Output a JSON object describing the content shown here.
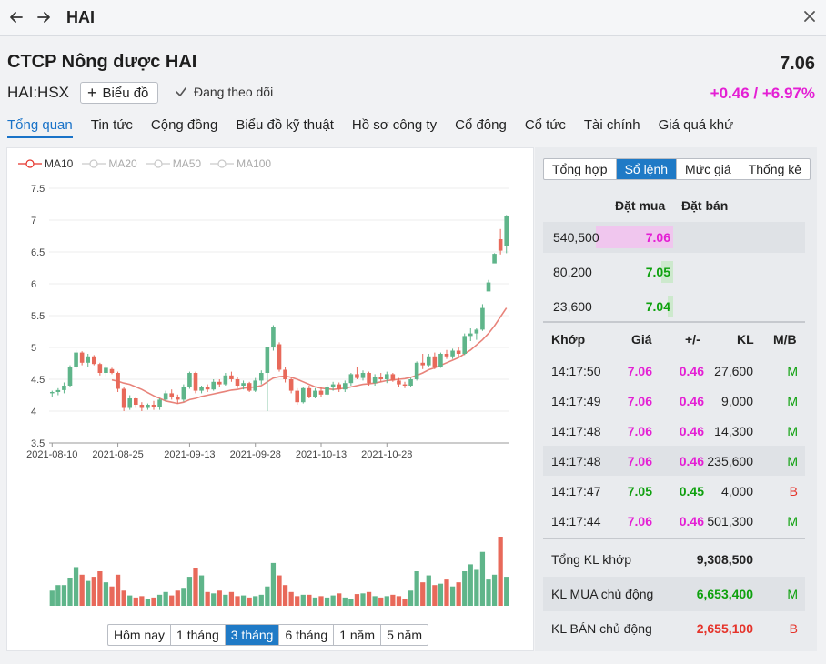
{
  "window": {
    "title": "HAI"
  },
  "header": {
    "company": "CTCP Nông dược HAI",
    "ticker": "HAI:HSX",
    "chart_button": "Biểu đồ",
    "follow_label": "Đang theo dõi",
    "price": "7.06",
    "change": "+0.46 / +6.97%",
    "change_color": "#e41fd4"
  },
  "tabs": [
    "Tổng quan",
    "Tin tức",
    "Cộng đồng",
    "Biểu đồ kỹ thuật",
    "Hồ sơ công ty",
    "Cổ đông",
    "Cổ tức",
    "Tài chính",
    "Giá quá khứ"
  ],
  "legend": [
    "MA10",
    "MA20",
    "MA50",
    "MA100"
  ],
  "range_buttons": [
    "Hôm nay",
    "1 tháng",
    "3 tháng",
    "6 tháng",
    "1 năm",
    "5 năm"
  ],
  "right_tabs": [
    "Tổng hợp",
    "Sổ lệnh",
    "Mức giá",
    "Thống kê"
  ],
  "order_book": {
    "head_buy": "Đặt mua",
    "head_sell": "Đặt bán",
    "rows": [
      {
        "volume": "540,500",
        "price": "7.06",
        "color": "#e41fd4",
        "bar_fraction": 1.0,
        "bar_color": "#f0c6ee"
      },
      {
        "volume": "80,200",
        "price": "7.05",
        "color": "#0ea10e",
        "bar_fraction": 0.15,
        "bar_color": "#cde9cd"
      },
      {
        "volume": "23,600",
        "price": "7.04",
        "color": "#0ea10e",
        "bar_fraction": 0.05,
        "bar_color": "#cde9cd"
      }
    ]
  },
  "trades": {
    "headers": {
      "time": "Khớp",
      "price": "Giá",
      "change": "+/-",
      "volume": "KL",
      "side": "M/B"
    },
    "rows": [
      {
        "time": "14:17:50",
        "price": "7.06",
        "change": "0.46",
        "volume": "27,600",
        "side": "M",
        "price_color": "pink",
        "side_color": "green"
      },
      {
        "time": "14:17:49",
        "price": "7.06",
        "change": "0.46",
        "volume": "9,000",
        "side": "M",
        "price_color": "pink",
        "side_color": "green"
      },
      {
        "time": "14:17:48",
        "price": "7.06",
        "change": "0.46",
        "volume": "14,300",
        "side": "M",
        "price_color": "pink",
        "side_color": "green"
      },
      {
        "time": "14:17:48",
        "price": "7.06",
        "change": "0.46",
        "volume": "235,600",
        "side": "M",
        "price_color": "pink",
        "side_color": "green"
      },
      {
        "time": "14:17:47",
        "price": "7.05",
        "change": "0.45",
        "volume": "4,000",
        "side": "B",
        "price_color": "green",
        "side_color": "red"
      },
      {
        "time": "14:17:44",
        "price": "7.06",
        "change": "0.46",
        "volume": "501,300",
        "side": "M",
        "price_color": "pink",
        "side_color": "green"
      }
    ]
  },
  "summary": [
    {
      "label": "Tổng KL khớp",
      "value": "9,308,500",
      "side": "",
      "color": "#222222"
    },
    {
      "label": "KL MUA chủ động",
      "value": "6,653,400",
      "side": "M",
      "color": "#0ea10e"
    },
    {
      "label": "KL BÁN chủ động",
      "value": "2,655,100",
      "side": "B",
      "color": "#e5332a"
    }
  ],
  "chart_data": {
    "type": "candlestick",
    "y_ticks": [
      "7.5",
      "7",
      "6.5",
      "6",
      "5.5",
      "5",
      "4.5",
      "4",
      "3.5"
    ],
    "ylim": [
      3.5,
      7.5
    ],
    "x_ticks": [
      "2021-08-10",
      "2021-08-25",
      "2021-09-13",
      "2021-09-28",
      "2021-10-13",
      "2021-10-28"
    ],
    "up_color": "#5fb58a",
    "down_color": "#e8695a",
    "ma_color": "#e8837a",
    "candles": [
      [
        4.28,
        4.32,
        4.22,
        4.3
      ],
      [
        4.3,
        4.36,
        4.25,
        4.33
      ],
      [
        4.33,
        4.45,
        4.28,
        4.4
      ],
      [
        4.4,
        4.72,
        4.38,
        4.7
      ],
      [
        4.7,
        4.96,
        4.66,
        4.92
      ],
      [
        4.92,
        4.94,
        4.72,
        4.76
      ],
      [
        4.76,
        4.9,
        4.7,
        4.86
      ],
      [
        4.86,
        4.88,
        4.72,
        4.74
      ],
      [
        4.74,
        4.76,
        4.56,
        4.6
      ],
      [
        4.6,
        4.72,
        4.55,
        4.68
      ],
      [
        4.66,
        4.68,
        4.58,
        4.6
      ],
      [
        4.6,
        4.62,
        4.3,
        4.35
      ],
      [
        4.35,
        4.38,
        4.0,
        4.05
      ],
      [
        4.05,
        4.25,
        4.02,
        4.2
      ],
      [
        4.2,
        4.22,
        4.05,
        4.1
      ],
      [
        4.1,
        4.14,
        4.0,
        4.05
      ],
      [
        4.05,
        4.12,
        4.02,
        4.1
      ],
      [
        4.1,
        4.16,
        4.02,
        4.06
      ],
      [
        4.06,
        4.2,
        4.02,
        4.18
      ],
      [
        4.18,
        4.32,
        4.15,
        4.28
      ],
      [
        4.28,
        4.34,
        4.18,
        4.22
      ],
      [
        4.22,
        4.26,
        4.12,
        4.18
      ],
      [
        4.18,
        4.42,
        4.15,
        4.38
      ],
      [
        4.38,
        4.62,
        4.35,
        4.6
      ],
      [
        4.6,
        4.62,
        4.28,
        4.32
      ],
      [
        4.32,
        4.4,
        4.28,
        4.38
      ],
      [
        4.38,
        4.42,
        4.3,
        4.34
      ],
      [
        4.34,
        4.5,
        4.32,
        4.46
      ],
      [
        4.46,
        4.5,
        4.38,
        4.42
      ],
      [
        4.42,
        4.6,
        4.4,
        4.56
      ],
      [
        4.56,
        4.62,
        4.46,
        4.5
      ],
      [
        4.5,
        4.54,
        4.36,
        4.4
      ],
      [
        4.4,
        4.48,
        4.34,
        4.44
      ],
      [
        4.44,
        4.46,
        4.3,
        4.32
      ],
      [
        4.32,
        4.52,
        4.3,
        4.48
      ],
      [
        4.48,
        4.64,
        4.42,
        4.6
      ],
      [
        4.6,
        4.62,
        4.0,
        5.0
      ],
      [
        5.0,
        5.35,
        4.95,
        5.32
      ],
      [
        5.05,
        5.08,
        4.62,
        4.65
      ],
      [
        4.65,
        4.7,
        4.45,
        4.5
      ],
      [
        4.5,
        4.52,
        4.28,
        4.32
      ],
      [
        4.32,
        4.36,
        4.1,
        4.14
      ],
      [
        4.14,
        4.38,
        4.12,
        4.36
      ],
      [
        4.36,
        4.4,
        4.2,
        4.22
      ],
      [
        4.22,
        4.36,
        4.2,
        4.32
      ],
      [
        4.32,
        4.38,
        4.22,
        4.26
      ],
      [
        4.26,
        4.42,
        4.24,
        4.38
      ],
      [
        4.38,
        4.46,
        4.32,
        4.42
      ],
      [
        4.42,
        4.45,
        4.3,
        4.34
      ],
      [
        4.34,
        4.48,
        4.3,
        4.44
      ],
      [
        4.44,
        4.6,
        4.4,
        4.58
      ],
      [
        4.58,
        4.7,
        4.5,
        4.52
      ],
      [
        4.52,
        4.64,
        4.48,
        4.6
      ],
      [
        4.6,
        4.62,
        4.4,
        4.44
      ],
      [
        4.44,
        4.58,
        4.4,
        4.54
      ],
      [
        4.54,
        4.6,
        4.46,
        4.5
      ],
      [
        4.5,
        4.62,
        4.44,
        4.58
      ],
      [
        4.58,
        4.6,
        4.46,
        4.48
      ],
      [
        4.48,
        4.52,
        4.38,
        4.42
      ],
      [
        4.42,
        4.46,
        4.36,
        4.4
      ],
      [
        4.4,
        4.52,
        4.38,
        4.5
      ],
      [
        4.5,
        4.78,
        4.48,
        4.76
      ],
      [
        4.76,
        4.9,
        4.66,
        4.72
      ],
      [
        4.72,
        4.9,
        4.7,
        4.86
      ],
      [
        4.86,
        4.92,
        4.66,
        4.7
      ],
      [
        4.7,
        4.92,
        4.68,
        4.9
      ],
      [
        4.9,
        4.96,
        4.82,
        4.86
      ],
      [
        4.86,
        4.98,
        4.82,
        4.95
      ],
      [
        4.95,
        5.0,
        4.84,
        4.9
      ],
      [
        4.9,
        5.22,
        4.88,
        5.18
      ],
      [
        5.18,
        5.3,
        5.1,
        5.22
      ],
      [
        5.22,
        5.3,
        5.12,
        5.28
      ],
      [
        5.28,
        5.68,
        5.26,
        5.62
      ],
      [
        5.88,
        6.06,
        5.9,
        6.02
      ],
      [
        6.32,
        6.48,
        6.45,
        6.47
      ],
      [
        6.7,
        6.86,
        6.46,
        6.52
      ],
      [
        6.6,
        7.08,
        6.48,
        7.06
      ]
    ],
    "ma10": [
      null,
      null,
      null,
      null,
      null,
      null,
      null,
      null,
      null,
      null,
      4.49,
      4.47,
      4.44,
      4.42,
      4.38,
      4.34,
      4.29,
      4.24,
      4.2,
      4.16,
      4.14,
      4.12,
      4.14,
      4.18,
      4.2,
      4.23,
      4.25,
      4.27,
      4.29,
      4.31,
      4.33,
      4.34,
      4.36,
      4.37,
      4.38,
      4.4,
      4.46,
      4.52,
      4.54,
      4.55,
      4.53,
      4.5,
      4.46,
      4.42,
      4.38,
      4.36,
      4.35,
      4.34,
      4.35,
      4.36,
      4.38,
      4.4,
      4.42,
      4.43,
      4.44,
      4.46,
      4.48,
      4.49,
      4.5,
      4.51,
      4.53,
      4.56,
      4.6,
      4.65,
      4.68,
      4.72,
      4.76,
      4.8,
      4.84,
      4.9,
      4.96,
      5.04,
      5.12,
      5.22,
      5.34,
      5.48,
      5.62
    ],
    "volumes": [
      0.22,
      0.3,
      0.3,
      0.4,
      0.56,
      0.45,
      0.36,
      0.42,
      0.5,
      0.34,
      0.28,
      0.45,
      0.22,
      0.15,
      0.12,
      0.14,
      0.1,
      0.12,
      0.16,
      0.2,
      0.15,
      0.22,
      0.26,
      0.42,
      0.55,
      0.44,
      0.2,
      0.18,
      0.22,
      0.16,
      0.2,
      0.14,
      0.15,
      0.12,
      0.14,
      0.16,
      0.28,
      0.62,
      0.44,
      0.3,
      0.2,
      0.14,
      0.16,
      0.16,
      0.12,
      0.14,
      0.12,
      0.15,
      0.18,
      0.12,
      0.1,
      0.17,
      0.18,
      0.2,
      0.14,
      0.12,
      0.14,
      0.16,
      0.14,
      0.1,
      0.22,
      0.5,
      0.34,
      0.44,
      0.3,
      0.32,
      0.38,
      0.28,
      0.34,
      0.5,
      0.6,
      0.52,
      0.78,
      0.38,
      0.45,
      1.0,
      0.42
    ],
    "volume_up": [
      1,
      1,
      1,
      1,
      1,
      0,
      1,
      0,
      0,
      1,
      0,
      0,
      0,
      1,
      0,
      0,
      1,
      0,
      1,
      1,
      0,
      0,
      1,
      1,
      0,
      1,
      0,
      1,
      0,
      1,
      0,
      0,
      1,
      0,
      1,
      1,
      1,
      1,
      0,
      0,
      0,
      0,
      1,
      0,
      1,
      0,
      1,
      1,
      0,
      1,
      1,
      0,
      1,
      0,
      1,
      0,
      1,
      0,
      0,
      0,
      1,
      1,
      0,
      1,
      0,
      1,
      0,
      1,
      0,
      1,
      1,
      1,
      1,
      1,
      1,
      0,
      1
    ]
  }
}
